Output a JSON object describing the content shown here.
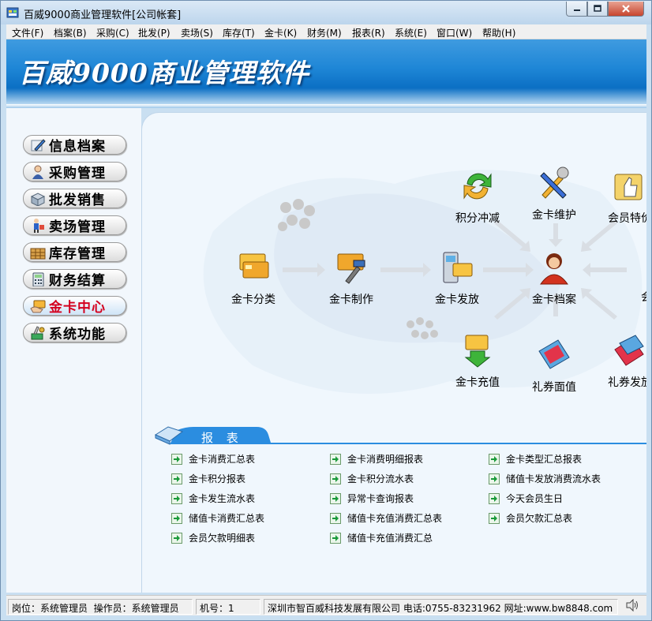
{
  "window": {
    "title": "百威9000商业管理软件[公司帐套]"
  },
  "menu": [
    "文件(F)",
    "档案(B)",
    "采购(C)",
    "批发(P)",
    "卖场(S)",
    "库存(T)",
    "金卡(K)",
    "财务(M)",
    "报表(R)",
    "系统(E)",
    "窗口(W)",
    "帮助(H)"
  ],
  "banner": {
    "title": "百威9000商业管理软件"
  },
  "sidebar": {
    "items": [
      {
        "label": "信息档案",
        "icon": "pen-icon"
      },
      {
        "label": "采购管理",
        "icon": "person-icon"
      },
      {
        "label": "批发销售",
        "icon": "box-icon"
      },
      {
        "label": "卖场管理",
        "icon": "shopper-icon"
      },
      {
        "label": "库存管理",
        "icon": "crate-icon"
      },
      {
        "label": "财务结算",
        "icon": "calculator-icon"
      },
      {
        "label": "金卡中心",
        "icon": "card-hand-icon",
        "active": true
      },
      {
        "label": "系统功能",
        "icon": "tools-icon"
      }
    ]
  },
  "flow": {
    "gold_card_type": "金卡分类",
    "gold_card_make": "金卡制作",
    "gold_card_issue": "金卡发放",
    "gold_card_archive": "金卡档案",
    "points_offset": "积分冲减",
    "gold_card_maintain": "金卡维护",
    "member_special_price": "会员特价",
    "member_right_cut": "会员",
    "gold_card_recharge": "金卡充值",
    "voucher_value": "礼券面值",
    "voucher_issue": "礼券发放"
  },
  "reports": {
    "title": "报 表",
    "columns": [
      [
        "金卡消费汇总表",
        "金卡积分报表",
        "金卡发生流水表",
        "储值卡消费汇总表",
        "会员欠款明细表"
      ],
      [
        "金卡消费明细报表",
        "金卡积分流水表",
        "异常卡查询报表",
        "储值卡充值消费汇总表",
        "储值卡充值消费汇总"
      ],
      [
        "金卡类型汇总报表",
        "储值卡发放消费流水表",
        "今天会员生日",
        "会员欠款汇总表"
      ]
    ]
  },
  "status": {
    "role": "岗位：系统管理员",
    "operator": "操作员：系统管理员",
    "machine": "机号：1",
    "company": "深圳市智百威科技发展有限公司 电话:0755-83231962 网址:www.bw8848.com"
  },
  "colors": {
    "accent": "#1e86d6",
    "active_nav": "#d4001e",
    "report_arrow": "#1a9a3a"
  }
}
